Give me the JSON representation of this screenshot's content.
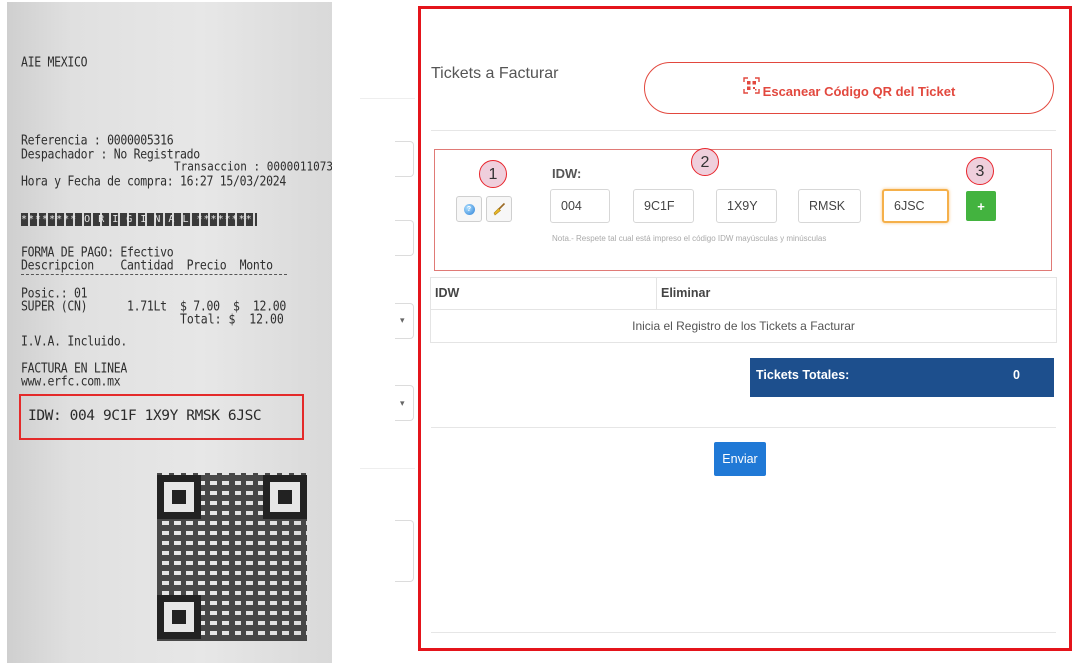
{
  "receipt": {
    "company": "AIE MEXICO",
    "reference": "Referencia : 0000005316",
    "dispatcher": "Despachador : No Registrado",
    "transaction": "Transaccion : 0000011073",
    "datetime": "Hora y Fecha de compra: 16:27 15/03/2024",
    "original_banner": "******** O R I G I N A L ********",
    "payment": "FORMA DE PAGO: Efectivo",
    "columns_header": "Descripcion    Cantidad  Precio  Monto",
    "position": "Posic.: 01",
    "item_line": "SUPER (CN)      1.71Lt  $ 7.00  $  12.00",
    "total_line": "Total: $  12.00",
    "iva": "I.V.A. Incluido.",
    "online_invoice": "FACTURA EN LINEA",
    "website": "www.erfc.com.mx",
    "idw_line": "IDW: 004 9C1F 1X9Y RMSK 6JSC"
  },
  "form": {
    "title": "Tickets a Facturar",
    "scan_button_label": "Escanear Código QR del Ticket",
    "idw_label": "IDW:",
    "idw_segments": [
      "004",
      "9C1F",
      "1X9Y",
      "RMSK",
      "6JSC"
    ],
    "add_button_label": "+",
    "note": "Nota.- Respete tal cual está impreso el código IDW mayúsculas y minúsculas",
    "markers": [
      "1",
      "2",
      "3"
    ],
    "table": {
      "headers": [
        "IDW",
        "Eliminar"
      ],
      "empty_message": "Inicia el Registro de los Tickets a Facturar"
    },
    "totals_label": "Tickets Totales:",
    "totals_value": "0",
    "submit_label": "Enviar"
  },
  "colors": {
    "highlight_border": "#e4141b",
    "scan_accent": "#e2483e",
    "add_button": "#43b33f",
    "totals_bg": "#1d4f8d",
    "submit_bg": "#2079d6"
  },
  "icons": [
    "help-icon",
    "broom-icon",
    "qr-scan-icon",
    "plus-icon"
  ]
}
